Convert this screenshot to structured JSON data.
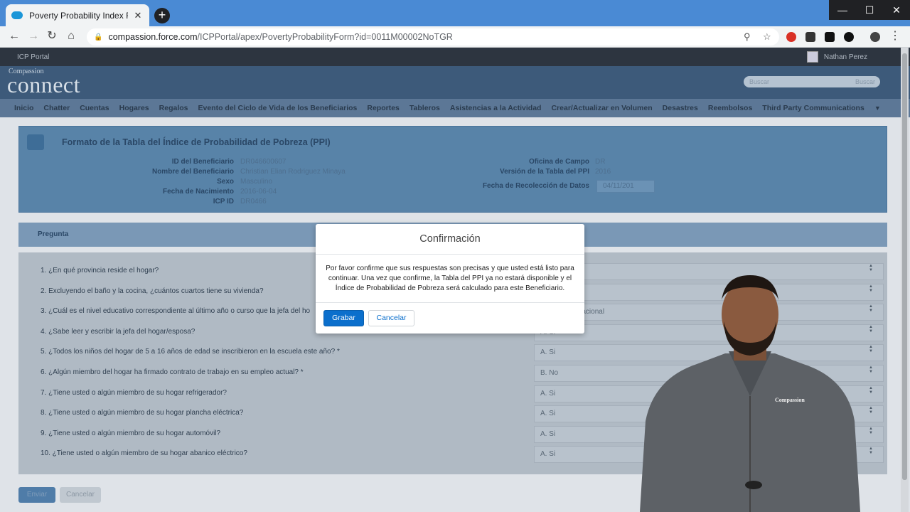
{
  "browser": {
    "tab_title": "Poverty Probability Index Form -",
    "tab_close": "✕",
    "new_tab": "+",
    "url_host": "compassion.force.com",
    "url_path": "/ICPPortal/apex/PovertyProbabilityForm?id=0011M00002NoTGR",
    "win_min": "—",
    "win_max": "☐",
    "win_close": "✕"
  },
  "portal": {
    "name": "ICP Portal",
    "user": "Nathan Perez",
    "logo_small": "Compassion",
    "logo": "connect",
    "search_placeholder": "Buscar",
    "search_button": "Buscar"
  },
  "menu": [
    "Inicio",
    "Chatter",
    "Cuentas",
    "Hogares",
    "Regalos",
    "Evento del Ciclo de Vida de los Beneficiarios",
    "Reportes",
    "Tableros",
    "Asistencias a la Actividad",
    "Crear/Actualizar en Volumen",
    "Desastres",
    "Reembolsos",
    "Third Party Communications"
  ],
  "form": {
    "title": "Formato de la Tabla del Índice de Probabilidad de Pobreza (PPI)",
    "left_fields": [
      {
        "label": "ID del Beneficiario",
        "value": "DR046600607"
      },
      {
        "label": "Nombre del Beneficiario",
        "value": "Christian Elian Rodriguez Minaya"
      },
      {
        "label": "Sexo",
        "value": "Masculino"
      },
      {
        "label": "Fecha de Nacimiento",
        "value": "2016-06-04"
      },
      {
        "label": "ICP ID",
        "value": "DR0466"
      }
    ],
    "right_fields": [
      {
        "label": "Oficina de Campo",
        "value": "DR"
      },
      {
        "label": "Versión de la Tabla del PPI",
        "value": "2016"
      },
      {
        "label": "Fecha de Recolección de Datos",
        "value": "04/11/201"
      }
    ]
  },
  "questions_header": "Pregunta",
  "questions": [
    {
      "text": "1. ¿En qué provincia reside el hogar?",
      "answer": ""
    },
    {
      "text": "2. Excluyendo el baño y la cocina, ¿cuántos cuartos tiene su vivienda?",
      "answer": ""
    },
    {
      "text": "3. ¿Cuál es el nivel educativo correspondiente al último año o curso que la jefa del ho",
      "answer": "o tecnico vocacional"
    },
    {
      "text": "4. ¿Sabe leer y escribir la jefa del hogar/esposa?",
      "answer": "A. Si"
    },
    {
      "text": "5. ¿Todos los niños del hogar de 5 a 16 años de edad se inscribieron en la escuela este año? *",
      "answer": "A. Si"
    },
    {
      "text": "6. ¿Algún miembro del hogar ha firmado contrato de trabajo en su empleo actual? *",
      "answer": "B. No"
    },
    {
      "text": "7. ¿Tiene usted o algún miembro de su hogar refrigerador?",
      "answer": "A. Si"
    },
    {
      "text": "8. ¿Tiene usted o algún miembro de su hogar plancha eléctrica?",
      "answer": "A. Si"
    },
    {
      "text": "9. ¿Tiene usted o algún miembro de su hogar automóvil?",
      "answer": "A. Si"
    },
    {
      "text": "10. ¿Tiene usted o algún miembro de su hogar abanico eléctrico?",
      "answer": "A. Si"
    }
  ],
  "footer": {
    "submit": "Enviar",
    "cancel": "Cancelar"
  },
  "modal": {
    "title": "Confirmación",
    "body": "Por favor confirme que sus respuestas son precisas y que usted está listo para continuar. Una vez que confirme, la Tabla del PPI ya no estará disponible y el Índice de Probabilidad de Pobreza será calculado para este Beneficiario.",
    "save": "Grabar",
    "cancel": "Cancelar"
  },
  "presenter": {
    "shirt_logo": "Compassion"
  }
}
